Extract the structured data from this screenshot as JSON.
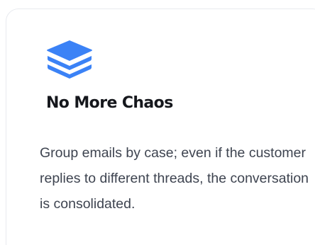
{
  "card": {
    "icon": "layers-icon",
    "accent_color": "#3b82f6",
    "title": "No More Chaos",
    "description": "Group emails by case; even if the customer replies to different threads, the conversation is consolidated."
  }
}
